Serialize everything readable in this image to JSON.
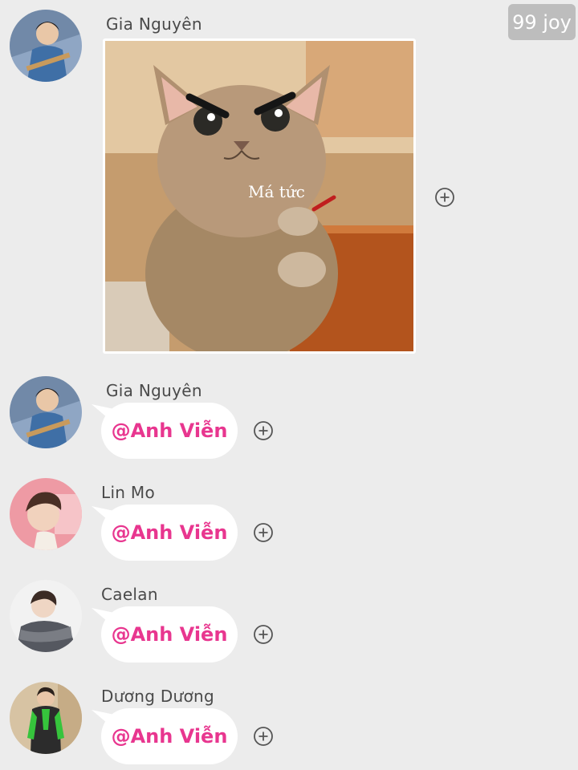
{
  "badge": {
    "text": "99 joy"
  },
  "messages": [
    {
      "sender": "Gia Nguyên",
      "type": "image",
      "image_caption": "Má tức"
    },
    {
      "sender": "Gia Nguyên",
      "type": "text",
      "text": "@Anh Viễn"
    },
    {
      "sender": "Lin Mo",
      "type": "text",
      "text": "@Anh Viễn"
    },
    {
      "sender": "Caelan",
      "type": "text",
      "text": "@Anh Viễn"
    },
    {
      "sender": "Dương Dương",
      "type": "text",
      "text": "@Anh Viễn"
    }
  ],
  "icons": {
    "add": "plus-circle-icon",
    "avatar": "avatar"
  },
  "colors": {
    "mention": "#e8368f",
    "background": "#ececec",
    "bubble": "#ffffff",
    "badge": "#bdbdbd"
  }
}
